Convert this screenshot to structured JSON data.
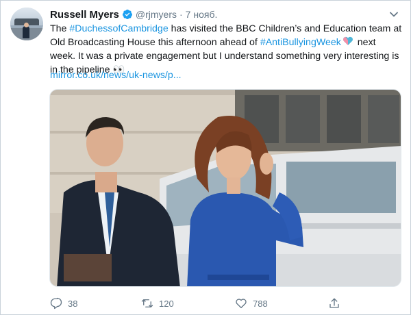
{
  "author": {
    "name": "Russell Myers",
    "handle": "@rjmyers",
    "separator": "·",
    "time": "7 нояб."
  },
  "tweet": {
    "seg1": "The ",
    "hashtag1": "#DuchessofCambridge",
    "seg2": " has visited the BBC Children’s and Education team at Old Broadcasting House this afternoon ahead of ",
    "hashtag2": "#AntiBullyingWeek",
    "seg3": " next week. It was a private engagement but I understand something very interesting is in the pipeline 👀",
    "link": "mirror.co.uk/news/uk-news/p..."
  },
  "actions": {
    "replies": "38",
    "retweets": "120",
    "likes": "788"
  },
  "icons": {
    "verified": "verified-badge-icon",
    "caret": "chevron-down-icon",
    "reply": "reply-icon",
    "retweet": "retweet-icon",
    "like": "heart-icon",
    "share": "share-icon"
  },
  "colors": {
    "link": "#1b95e0",
    "muted": "#657786",
    "text": "#14171a"
  }
}
